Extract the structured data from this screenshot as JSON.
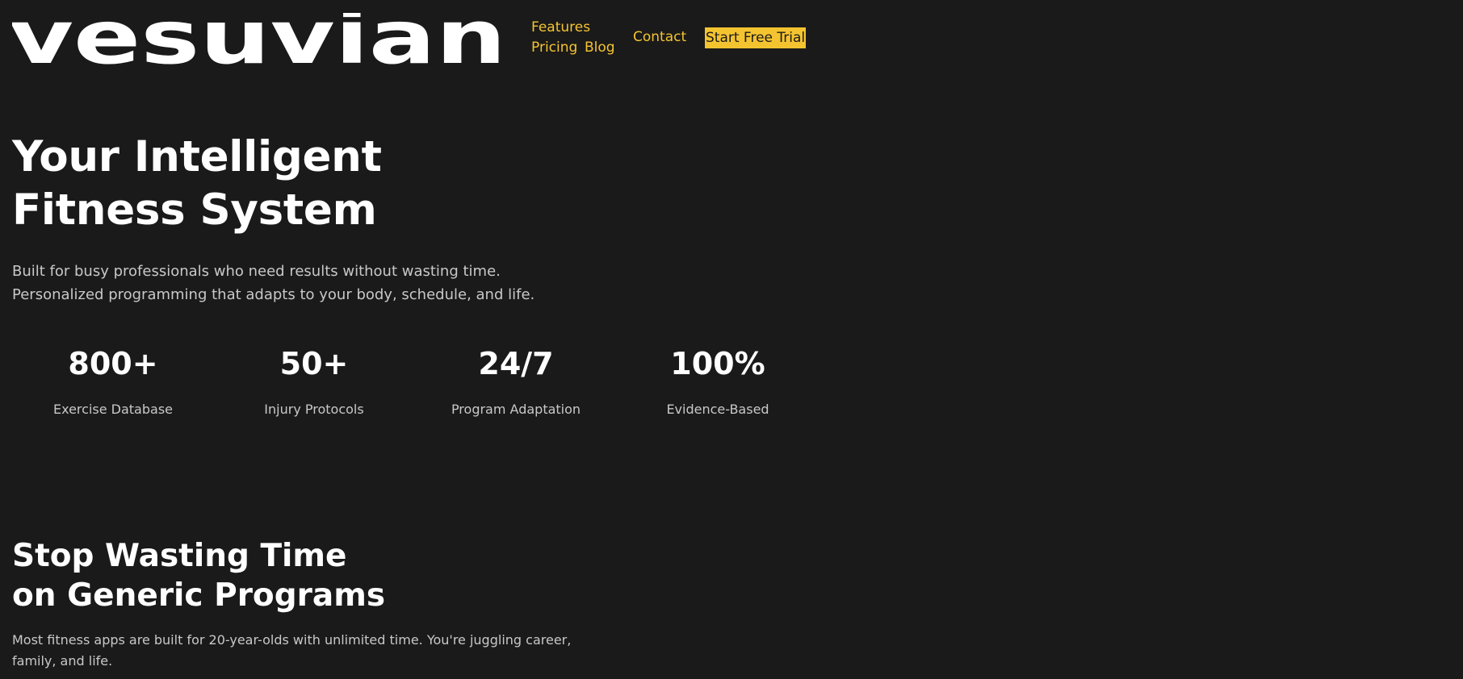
{
  "brand": {
    "logo_text": "vesuvian"
  },
  "nav": {
    "features": "Features",
    "pricing": "Pricing",
    "blog": "Blog",
    "contact": "Contact",
    "cta": "Start Free Trial"
  },
  "hero": {
    "title_line1": "Your Intelligent",
    "title_line2": "Fitness System",
    "subtitle_line1": "Built for busy professionals who need results without wasting time.",
    "subtitle_line2": "Personalized programming that adapts to your body, schedule, and life."
  },
  "stats": [
    {
      "value": "800+",
      "label": "Exercise Database"
    },
    {
      "value": "50+",
      "label": "Injury Protocols"
    },
    {
      "value": "24/7",
      "label": "Program Adaptation"
    },
    {
      "value": "100%",
      "label": "Evidence-Based"
    }
  ],
  "section": {
    "title_line1": "Stop Wasting Time",
    "title_line2": "on Generic Programs",
    "text": "Most fitness apps are built for 20-year-olds with unlimited time. You're juggling career, family, and life."
  },
  "colors": {
    "background": "#1b1a1a",
    "accent": "#f4c430",
    "text": "#ffffff",
    "muted_text": "#c8c8c8"
  }
}
